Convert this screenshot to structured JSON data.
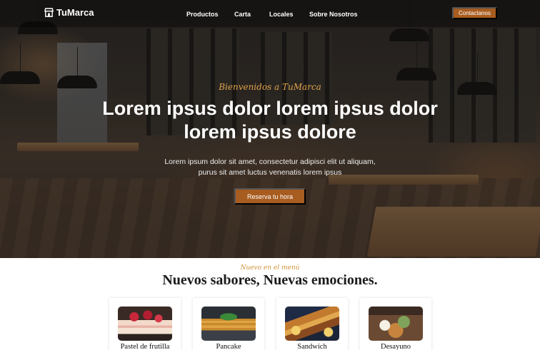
{
  "brand": {
    "name": "TuMarca",
    "icon": "storefront-icon"
  },
  "nav": {
    "links": [
      "Productos",
      "Carta",
      "Locales",
      "Sobre Nosotros"
    ],
    "cta": "Contactanos"
  },
  "hero": {
    "eyebrow": "Bienvenidos a TuMarca",
    "headline_line1": "Lorem ipsus dolor lorem ipsus dolor",
    "headline_line2": "lorem ipsus dolore",
    "sub_line1": "Lorem ipsum dolor sit amet, consectetur adipisci elit ut aliquam,",
    "sub_line2": "purus sit amet luctus venenatis lorem ipsus",
    "button": "Reserva tu hora"
  },
  "menu": {
    "eyebrow": "Nuevo en el menú",
    "title": "Nuevos sabores, Nuevas emociones.",
    "items": [
      {
        "label": "Pastel de frutilla"
      },
      {
        "label": "Pancake"
      },
      {
        "label": "Sandwich"
      },
      {
        "label": "Desayuno"
      }
    ]
  },
  "colors": {
    "accent": "#a85d20",
    "eyebrow": "#e0a24a"
  }
}
